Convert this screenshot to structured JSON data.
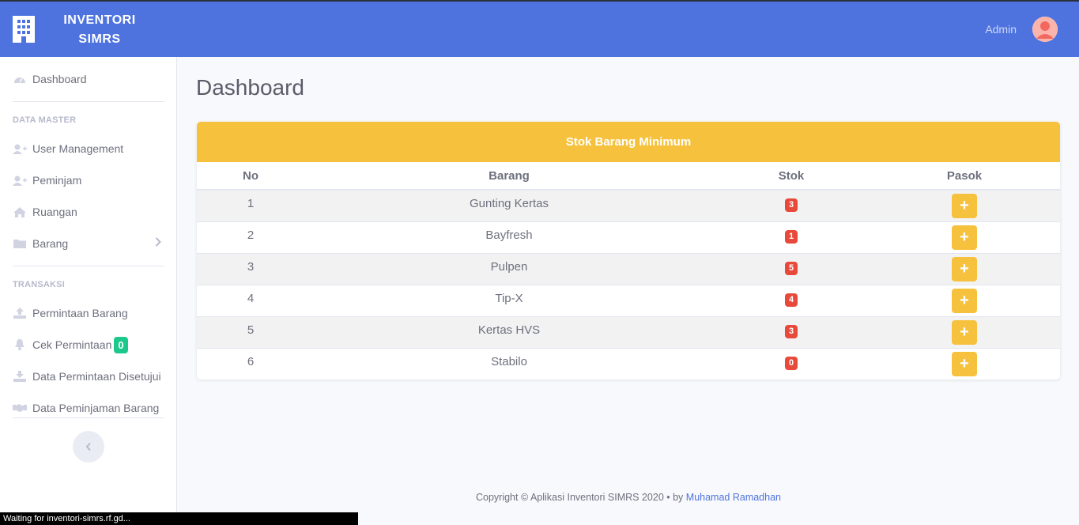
{
  "brand": {
    "line1": "INVENTORI",
    "line2": "SIMRS",
    "icon": "building-icon"
  },
  "topbar": {
    "user_name": "Admin",
    "avatar_icon": "user-avatar-icon"
  },
  "sidebar": {
    "dashboard": {
      "label": "Dashboard",
      "icon": "tachometer-icon"
    },
    "heading_master": "DATA MASTER",
    "master_items": [
      {
        "label": "User Management",
        "icon": "user-plus-icon"
      },
      {
        "label": "Peminjam",
        "icon": "user-plus-icon"
      },
      {
        "label": "Ruangan",
        "icon": "home-icon"
      },
      {
        "label": "Barang",
        "icon": "folder-icon"
      }
    ],
    "heading_transaksi": "TRANSAKSI",
    "transaksi_items": [
      {
        "label": "Permintaan Barang",
        "icon": "upload-icon"
      },
      {
        "label": "Cek Permintaan",
        "icon": "bell-icon",
        "badge": "0"
      },
      {
        "label": "Data Permintaan Disetujui",
        "icon": "download-icon"
      },
      {
        "label": "Data Peminjaman Barang",
        "icon": "handshake-icon"
      }
    ],
    "toggle_icon": "chevron-left-icon"
  },
  "main": {
    "title": "Dashboard",
    "card_title": "Stok Barang Minimum",
    "columns": [
      "No",
      "Barang",
      "Stok",
      "Pasok"
    ],
    "rows": [
      {
        "no": "1",
        "barang": "Gunting Kertas",
        "stok": "3"
      },
      {
        "no": "2",
        "barang": "Bayfresh",
        "stok": "1"
      },
      {
        "no": "3",
        "barang": "Pulpen",
        "stok": "5"
      },
      {
        "no": "4",
        "barang": "Tip-X",
        "stok": "4"
      },
      {
        "no": "5",
        "barang": "Kertas HVS",
        "stok": "3"
      },
      {
        "no": "6",
        "barang": "Stabilo",
        "stok": "0"
      }
    ],
    "pasok_label": "+"
  },
  "footer": {
    "text": "Copyright © Aplikasi Inventori SIMRS 2020 • by ",
    "author": "Muhamad Ramadhan"
  },
  "status_bar": "Waiting for inventori-simrs.rf.gd...",
  "colors": {
    "primary": "#4e73df",
    "warning": "#f6c23e",
    "danger": "#e74a3b",
    "success": "#1cc88a"
  }
}
